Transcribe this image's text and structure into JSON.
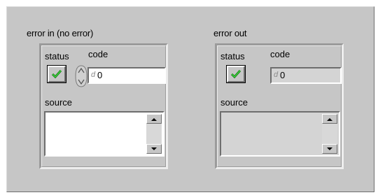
{
  "error_in": {
    "title": "error in (no error)",
    "status_label": "status",
    "code_label": "code",
    "code_radix": "d",
    "code_value": "0",
    "source_label": "source",
    "source_value": ""
  },
  "error_out": {
    "title": "error out",
    "status_label": "status",
    "code_label": "code",
    "code_radix": "d",
    "code_value": "0",
    "source_label": "source",
    "source_value": ""
  },
  "colors": {
    "panel": "#c6c6c6",
    "check_green": "#1fa51f",
    "input_bg": "#ffffff",
    "readonly_bg": "#d4d4d4"
  },
  "icons": {
    "status": "checkmark-icon",
    "spinner": "increment-decrement-icon",
    "scroll_up": "scroll-up-arrow-icon",
    "scroll_down": "scroll-down-arrow-icon"
  }
}
